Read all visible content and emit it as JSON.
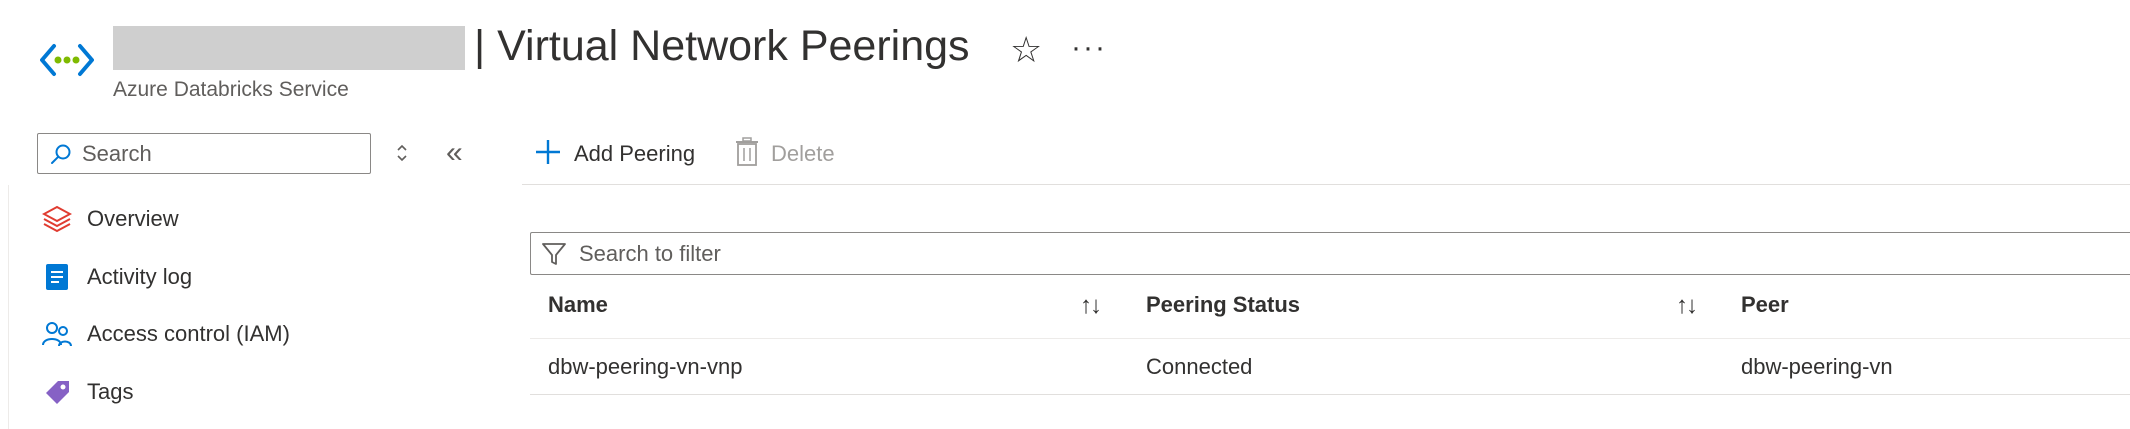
{
  "header": {
    "title": "| Virtual Network Peerings",
    "subtitle": "Azure Databricks Service",
    "favorite_icon": "star-icon",
    "more_icon": "ellipsis-icon",
    "more_label": "···"
  },
  "sidebar": {
    "search": {
      "placeholder": "Search"
    },
    "collapse_label": "«",
    "items": [
      {
        "label": "Overview",
        "icon": "databricks-icon"
      },
      {
        "label": "Activity log",
        "icon": "activity-log-icon"
      },
      {
        "label": "Access control (IAM)",
        "icon": "users-icon"
      },
      {
        "label": "Tags",
        "icon": "tag-icon"
      }
    ]
  },
  "toolbar": {
    "add_label": "Add Peering",
    "delete_label": "Delete"
  },
  "filter": {
    "placeholder": "Search to filter"
  },
  "table": {
    "columns": [
      "Name",
      "Peering Status",
      "Peer"
    ],
    "sort_glyph": "↑↓",
    "rows": [
      {
        "name": "dbw-peering-vn-vnp",
        "status": "Connected",
        "peer": "dbw-peering-vn"
      }
    ]
  },
  "colors": {
    "accent": "#0078d4",
    "disabled": "#a19f9d",
    "text": "#323130"
  }
}
